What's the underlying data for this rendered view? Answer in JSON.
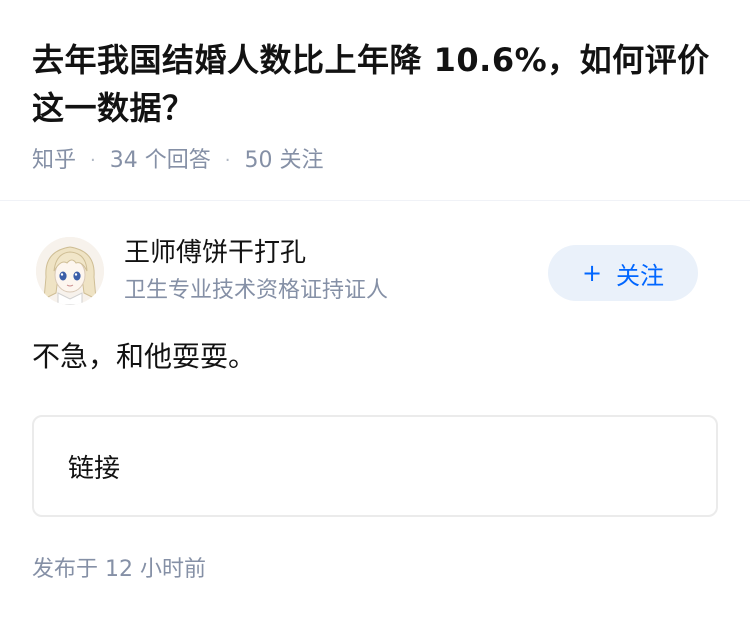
{
  "question": {
    "title": "去年我国结婚人数比上年降 10.6%，如何评价这一数据？",
    "source": "知乎",
    "separator": "·",
    "answer_count": "34 个回答",
    "follower_count": "50 关注"
  },
  "answer": {
    "author": {
      "name": "王师傅饼干打孔",
      "headline": "卫生专业技术资格证持证人",
      "avatar_icon": "anime-girl-avatar"
    },
    "follow_button": {
      "icon": "plus-icon",
      "plus_glyph": "+",
      "label": "关注"
    },
    "content": "不急，和他耍耍。",
    "link_card_label": "链接",
    "published_time": "发布于 12 小时前"
  },
  "colors": {
    "primary": "#0066ff",
    "follow_bg": "#eaf1fa",
    "meta_text": "#8590a6",
    "title_text": "#121212",
    "border": "#ebebeb"
  }
}
